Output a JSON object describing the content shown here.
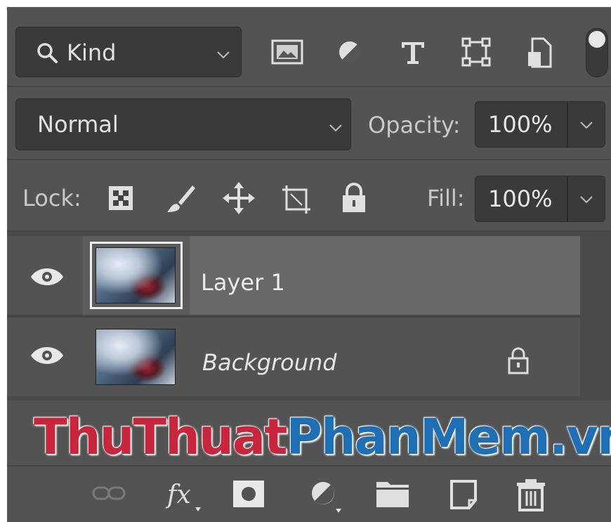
{
  "filter": {
    "kind_label": "Kind"
  },
  "blend": {
    "mode": "Normal",
    "opacity_label": "Opacity:",
    "opacity_value": "100%"
  },
  "lock": {
    "label": "Lock:",
    "fill_label": "Fill:",
    "fill_value": "100%"
  },
  "layers": [
    {
      "name": "Layer 1",
      "visible": true,
      "selected": true,
      "locked": false
    },
    {
      "name": "Background",
      "visible": true,
      "selected": false,
      "locked": true
    }
  ],
  "watermark": {
    "part1": "ThuThuat",
    "part2": "PhanMem.vn",
    "color1": "#c8263c",
    "color2": "#1f6fb5"
  },
  "colors": {
    "panel_bg": "#535353",
    "field_bg": "#3a3a3a",
    "selected_bg": "#686868",
    "text": "#d6d6d6"
  }
}
